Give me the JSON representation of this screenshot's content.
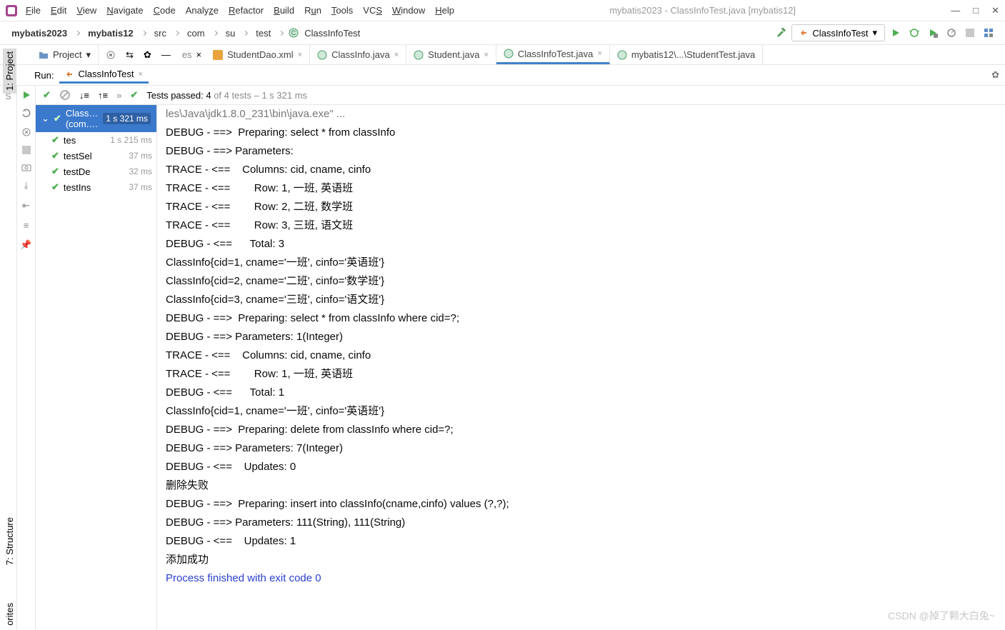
{
  "window": {
    "title": "mybatis2023 - ClassInfoTest.java [mybatis12]"
  },
  "menu": {
    "file": "File",
    "edit": "Edit",
    "view": "View",
    "navigate": "Navigate",
    "code": "Code",
    "analyze": "Analyze",
    "refactor": "Refactor",
    "build": "Build",
    "run": "Run",
    "tools": "Tools",
    "vcs": "VCS",
    "window": "Window",
    "help": "Help"
  },
  "breadcrumb": {
    "items": [
      "mybatis2023",
      "mybatis12",
      "src",
      "com",
      "su",
      "test",
      "ClassInfoTest"
    ]
  },
  "run_config": {
    "selected": "ClassInfoTest"
  },
  "project_label": "Project",
  "file_tabs": {
    "cut": "es",
    "items": [
      {
        "label": "StudentDao.xml",
        "icon": "xml"
      },
      {
        "label": "ClassInfo.java",
        "icon": "class"
      },
      {
        "label": "Student.java",
        "icon": "class"
      },
      {
        "label": "ClassInfoTest.java",
        "icon": "class",
        "active": true
      },
      {
        "label": "mybatis12\\...\\StudentTest.java",
        "icon": "class"
      }
    ]
  },
  "run_header": {
    "label": "Run:",
    "tab": "ClassInfoTest"
  },
  "left_gutter": {
    "project": "1: Project",
    "structure": "7: Structure",
    "favorites": "orites"
  },
  "test_status": {
    "passed_label": "Tests passed:",
    "passed": "4",
    "of": " of 4 tests",
    "dash": " – ",
    "duration": "1 s 321 ms",
    "expand_arrows": "»"
  },
  "tree": {
    "root": {
      "label": "ClassInfoTest (com.su.test)",
      "duration": "1 s 321 ms"
    },
    "items": [
      {
        "label": "tes",
        "duration": "1 s 215 ms"
      },
      {
        "label": "testSel",
        "duration": "37 ms"
      },
      {
        "label": "testDe",
        "duration": "32 ms"
      },
      {
        "label": "testIns",
        "duration": "37 ms"
      }
    ]
  },
  "console": {
    "head": "les\\Java\\jdk1.8.0_231\\bin\\java.exe\" ...",
    "lines": [
      "DEBUG - ==>  Preparing: select * from classInfo",
      "DEBUG - ==> Parameters:",
      "TRACE - <==    Columns: cid, cname, cinfo",
      "TRACE - <==        Row: 1, 一班, 英语班",
      "TRACE - <==        Row: 2, 二班, 数学班",
      "TRACE - <==        Row: 3, 三班, 语文班",
      "DEBUG - <==      Total: 3",
      "ClassInfo{cid=1, cname='一班', cinfo='英语班'}",
      "ClassInfo{cid=2, cname='二班', cinfo='数学班'}",
      "ClassInfo{cid=3, cname='三班', cinfo='语文班'}",
      "DEBUG - ==>  Preparing: select * from classInfo where cid=?;",
      "DEBUG - ==> Parameters: 1(Integer)",
      "TRACE - <==    Columns: cid, cname, cinfo",
      "TRACE - <==        Row: 1, 一班, 英语班",
      "DEBUG - <==      Total: 1",
      "ClassInfo{cid=1, cname='一班', cinfo='英语班'}",
      "DEBUG - ==>  Preparing: delete from classInfo where cid=?;",
      "DEBUG - ==> Parameters: 7(Integer)",
      "DEBUG - <==    Updates: 0",
      "删除失败",
      "DEBUG - ==>  Preparing: insert into classInfo(cname,cinfo) values (?,?);",
      "DEBUG - ==> Parameters: 111(String), 111(String)",
      "DEBUG - <==    Updates: 1",
      "添加成功",
      "",
      "Process finished with exit code 0"
    ]
  },
  "watermark": "CSDN @掉了颗大白兔~"
}
